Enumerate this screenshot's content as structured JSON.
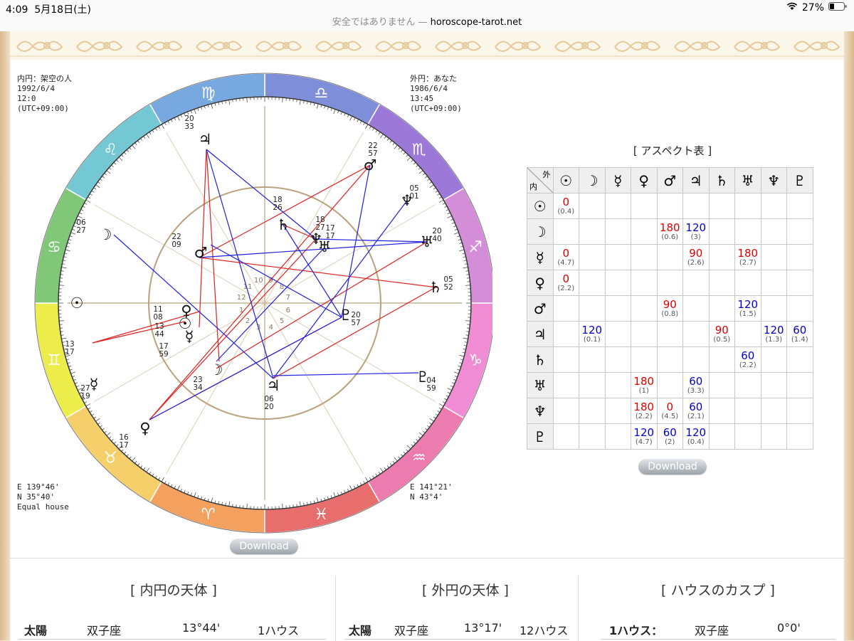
{
  "status_bar": {
    "time": "4:09",
    "date": "5月18日(土)",
    "battery": "27%"
  },
  "url_bar": {
    "security": "安全ではありません",
    "separator": " — ",
    "host": "horoscope-tarot.net"
  },
  "chart": {
    "inner_info": "内円：架空の人\n1992/6/4\n12:0\n(UTC+09:00)",
    "outer_info": "外円：あなた\n1986/6/4\n13:45\n(UTC+09:00)",
    "inner_loc": "E 139°46'\nN 35°40'\nEqual house",
    "outer_loc": "E 141°21'\nN 43°4'",
    "download_label": "Download",
    "zodiac_signs": [
      "♊",
      "♉",
      "♈",
      "♓",
      "♒",
      "♑",
      "♐",
      "♏",
      "♎",
      "♍",
      "♌",
      "♋"
    ],
    "sign_colors": [
      "#ecec4a",
      "#f5d06a",
      "#f4a160",
      "#e86e6e",
      "#ec7cb0",
      "#f08cd4",
      "#d48ed8",
      "#9c78d8",
      "#7f8ed8",
      "#78a8e0",
      "#74c8d4",
      "#80c878"
    ],
    "house_numbers": [
      "1",
      "2",
      "3",
      "4",
      "5",
      "6",
      "7",
      "8",
      "9",
      "10",
      "11",
      "12"
    ],
    "outer_planets": [
      {
        "glyph": "☉",
        "deg": "13",
        "min": "17"
      },
      {
        "glyph": "☿",
        "deg": "27",
        "min": "19"
      },
      {
        "glyph": "♀",
        "deg": "16",
        "min": "17"
      },
      {
        "glyph": "♇",
        "deg": "04",
        "min": "59"
      },
      {
        "glyph": "♄",
        "deg": "05",
        "min": "52"
      },
      {
        "glyph": "♅",
        "deg": "20",
        "min": "40"
      },
      {
        "glyph": "♆",
        "deg": "05",
        "min": "01"
      },
      {
        "glyph": "♂",
        "deg": "22",
        "min": "57"
      },
      {
        "glyph": "♃",
        "deg": "20",
        "min": "33"
      },
      {
        "glyph": "☽",
        "deg": "06",
        "min": "27"
      }
    ],
    "inner_planets": [
      {
        "glyph": "☉",
        "deg": "11",
        "min": "08"
      },
      {
        "glyph": "♀",
        "deg": "13",
        "min": "44"
      },
      {
        "glyph": "☿",
        "deg": "17",
        "min": "59"
      },
      {
        "glyph": "♂",
        "deg": "22",
        "min": "09"
      },
      {
        "glyph": "♄",
        "deg": "18",
        "min": "26"
      },
      {
        "glyph": "♆",
        "deg": "18",
        "min": "27"
      },
      {
        "glyph": "♅",
        "deg": "17",
        "min": "17"
      },
      {
        "glyph": "♇",
        "deg": "20",
        "min": "57"
      },
      {
        "glyph": "♃",
        "deg": "06",
        "min": "20"
      },
      {
        "glyph": "☽",
        "deg": "23",
        "min": "34"
      }
    ]
  },
  "aspect_table": {
    "title": "[ アスペクト表 ]",
    "corner_outer": "外",
    "corner_inner": "内",
    "download_label": "Download",
    "headers": [
      "☉",
      "☽",
      "☿",
      "♀",
      "♂",
      "♃",
      "♄",
      "♅",
      "♆",
      "♇"
    ],
    "rows": [
      {
        "glyph": "☉",
        "cells": [
          {
            "v": "0",
            "o": "(0.4)",
            "c": "red"
          },
          null,
          null,
          null,
          null,
          null,
          null,
          null,
          null,
          null
        ]
      },
      {
        "glyph": "☽",
        "cells": [
          null,
          null,
          null,
          null,
          {
            "v": "180",
            "o": "(0.6)",
            "c": "red"
          },
          {
            "v": "120",
            "o": "(3)",
            "c": "blue"
          },
          null,
          null,
          null,
          null
        ]
      },
      {
        "glyph": "☿",
        "cells": [
          {
            "v": "0",
            "o": "(4.7)",
            "c": "red"
          },
          null,
          null,
          null,
          null,
          {
            "v": "90",
            "o": "(2.6)",
            "c": "red"
          },
          null,
          {
            "v": "180",
            "o": "(2.7)",
            "c": "red"
          },
          null,
          null
        ]
      },
      {
        "glyph": "♀",
        "cells": [
          {
            "v": "0",
            "o": "(2.2)",
            "c": "red"
          },
          null,
          null,
          null,
          null,
          null,
          null,
          null,
          null,
          null
        ]
      },
      {
        "glyph": "♂",
        "cells": [
          null,
          null,
          null,
          null,
          {
            "v": "90",
            "o": "(0.8)",
            "c": "red"
          },
          null,
          null,
          {
            "v": "120",
            "o": "(1.5)",
            "c": "blue"
          },
          null,
          null
        ]
      },
      {
        "glyph": "♃",
        "cells": [
          null,
          {
            "v": "120",
            "o": "(0.1)",
            "c": "blue"
          },
          null,
          null,
          null,
          null,
          {
            "v": "90",
            "o": "(0.5)",
            "c": "red"
          },
          null,
          {
            "v": "120",
            "o": "(1.3)",
            "c": "blue"
          },
          {
            "v": "60",
            "o": "(1.4)",
            "c": "blue"
          }
        ]
      },
      {
        "glyph": "♄",
        "cells": [
          null,
          null,
          null,
          null,
          null,
          null,
          null,
          {
            "v": "60",
            "o": "(2.2)",
            "c": "blue"
          },
          null,
          null
        ]
      },
      {
        "glyph": "♅",
        "cells": [
          null,
          null,
          null,
          {
            "v": "180",
            "o": "(1)",
            "c": "red"
          },
          null,
          {
            "v": "60",
            "o": "(3.3)",
            "c": "blue"
          },
          null,
          null,
          null,
          null
        ]
      },
      {
        "glyph": "♆",
        "cells": [
          null,
          null,
          null,
          {
            "v": "180",
            "o": "(2.2)",
            "c": "red"
          },
          {
            "v": "0",
            "o": "(4.5)",
            "c": "red"
          },
          {
            "v": "60",
            "o": "(2.1)",
            "c": "blue"
          },
          null,
          null,
          null,
          null
        ]
      },
      {
        "glyph": "♇",
        "cells": [
          null,
          null,
          null,
          {
            "v": "120",
            "o": "(4.7)",
            "c": "blue"
          },
          {
            "v": "60",
            "o": "(2)",
            "c": "blue"
          },
          {
            "v": "120",
            "o": "(0.4)",
            "c": "blue"
          },
          null,
          null,
          null,
          null
        ]
      }
    ]
  },
  "sections": {
    "inner": {
      "title": "[ 内円の天体 ]",
      "row": {
        "planet": "太陽",
        "sign": "双子座",
        "degree": "13°44'",
        "house": "1ハウス"
      }
    },
    "outer": {
      "title": "[ 外円の天体 ]",
      "row": {
        "planet": "太陽",
        "sign": "双子座",
        "degree": "13°17'",
        "house": "12ハウス"
      }
    },
    "cusps": {
      "title": "[ ハウスのカスプ ]",
      "row": {
        "house": "1ハウス：",
        "sign": "双子座",
        "degree": "0°0'"
      }
    }
  }
}
